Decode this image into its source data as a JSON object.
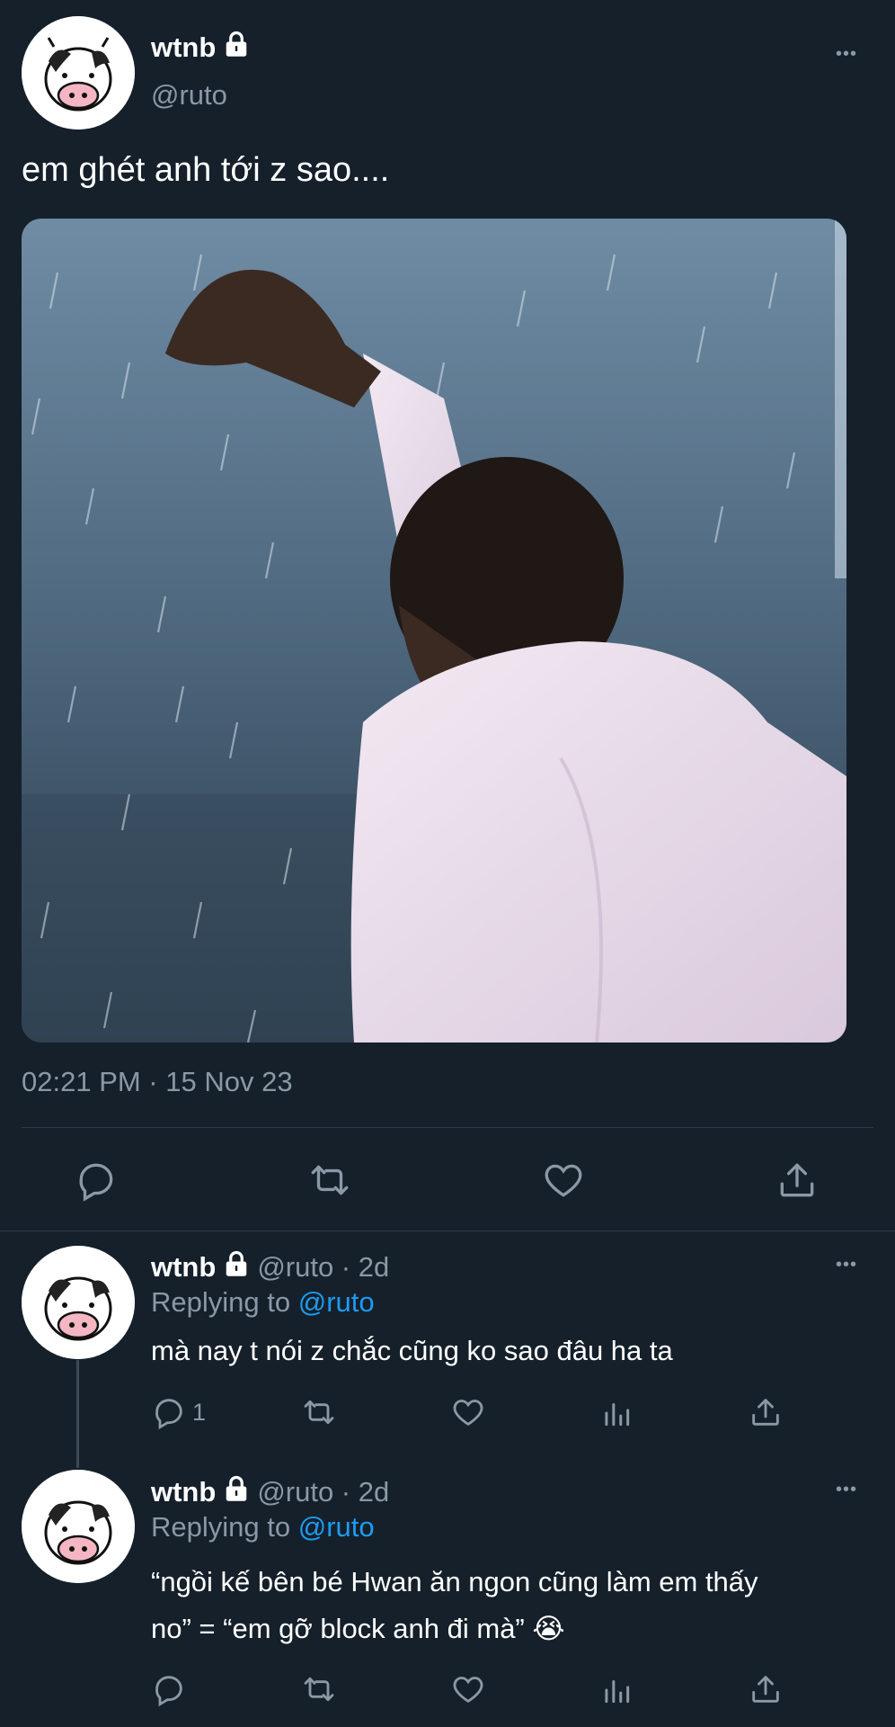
{
  "main_tweet": {
    "display_name": "wtnb",
    "handle": "@ruto",
    "text": "em ghét anh tới z sao....",
    "timestamp": "02:21 PM · 15 Nov 23",
    "more_label": "•••",
    "image_description_icon": "photo"
  },
  "replies": [
    {
      "display_name": "wtnb",
      "handle_time": "@ruto · 2d",
      "replying_prefix": "Replying to",
      "replying_to": "@ruto",
      "text": "mà nay t nói z chắc cũng ko sao đâu ha ta",
      "reply_count": "1",
      "more_label": "•••"
    },
    {
      "display_name": "wtnb",
      "handle_time": "@ruto · 2d",
      "replying_prefix": "Replying to",
      "replying_to": "@ruto",
      "text_line1": "“ngồi kế bên bé Hwan ăn ngon cũng làm em thấy",
      "text_line2": "no” = “em gỡ block anh đi mà” 😭",
      "reply_count": "",
      "more_label": "•••"
    }
  ],
  "icons": [
    "reply-icon",
    "retweet-icon",
    "like-icon",
    "share-icon",
    "analytics-icon",
    "lock-icon"
  ],
  "colors": {
    "background": "#15202b",
    "text": "#ffffff",
    "muted": "#8b98a5",
    "link": "#1d9bf0",
    "divider": "#2f3b47"
  }
}
